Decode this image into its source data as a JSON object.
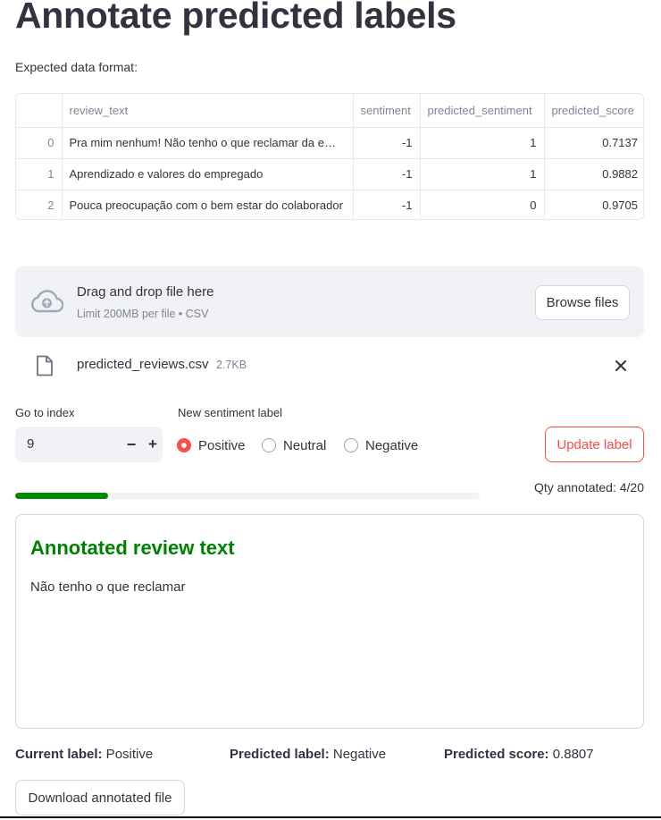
{
  "page": {
    "title": "Annotate predicted labels",
    "subtitle": "Expected data format:"
  },
  "dataframe": {
    "columns": [
      "",
      "review_text",
      "sentiment",
      "predicted_sentiment",
      "predicted_score"
    ],
    "rows": [
      [
        "0",
        "Pra mim nenhum! Não tenho o que reclamar da em…",
        "-1",
        "1",
        "0.7137"
      ],
      [
        "1",
        "Aprendizado e valores do empregado",
        "-1",
        "1",
        "0.9882"
      ],
      [
        "2",
        "Pouca preocupação com o bem estar do colaborador",
        "-1",
        "0",
        "0.9705"
      ]
    ]
  },
  "uploader": {
    "drag_text": "Drag and drop file here",
    "limit_text": "Limit 200MB per file • CSV",
    "browse_label": "Browse files",
    "file_name": "predicted_reviews.csv",
    "file_size": "2.7KB"
  },
  "controls": {
    "index_label": "Go to index",
    "index_value": "9",
    "minus": "−",
    "plus": "+",
    "sentiment_label": "New sentiment label",
    "options": [
      "Positive",
      "Neutral",
      "Negative"
    ],
    "selected": "Positive",
    "update_label": "Update label"
  },
  "progress": {
    "fraction": 0.2,
    "qty_text": "Qty annotated: 4/20"
  },
  "review": {
    "heading": "Annotated review text",
    "text": "Não tenho o que reclamar"
  },
  "stats": {
    "current_key": "Current label:",
    "current_value": " Positive",
    "predicted_key": "Predicted label:",
    "predicted_value": " Negative",
    "score_key": "Predicted score:",
    "score_value": " 0.8807"
  },
  "download_label": "Download annotated file",
  "colors": {
    "accent": "#ff4b4b",
    "progress": "#008a00",
    "heading": "#008000"
  },
  "icons": [
    "cloud-upload-icon",
    "file-icon",
    "close-icon"
  ]
}
